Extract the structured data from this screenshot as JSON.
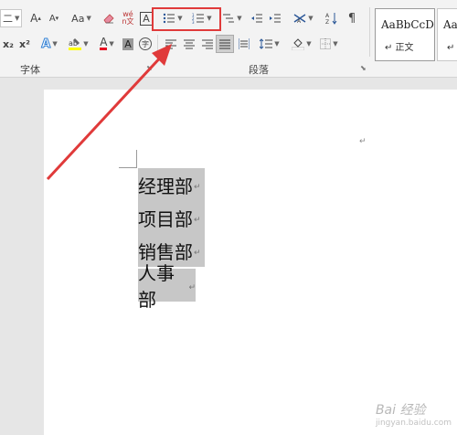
{
  "ribbon": {
    "font_group_label": "字体",
    "paragraph_group_label": "段落",
    "font_size_partial": "二",
    "change_case_label": "Aa",
    "subscript_label": "x₂",
    "superscript_label": "x²",
    "phonetic_label": "wén文",
    "char_border_label": "A",
    "char_shading_label": "A",
    "enclosed_char_label": "字"
  },
  "styles": {
    "items": [
      {
        "sample": "AaBbCcD",
        "name": "↵ 正文"
      },
      {
        "sample": "AaBbC",
        "name": "↵ 无"
      }
    ]
  },
  "document": {
    "lines": [
      "经理部",
      "项目部",
      "销售部",
      "人事部"
    ],
    "paragraph_mark": "↵"
  },
  "watermark": {
    "text": "Bai 经验",
    "sub": "jingyan.baidu.com"
  },
  "colors": {
    "highlight": "#e03a3a",
    "selection": "#c7c7c7",
    "ribbon_bg": "#f3f3f3"
  }
}
